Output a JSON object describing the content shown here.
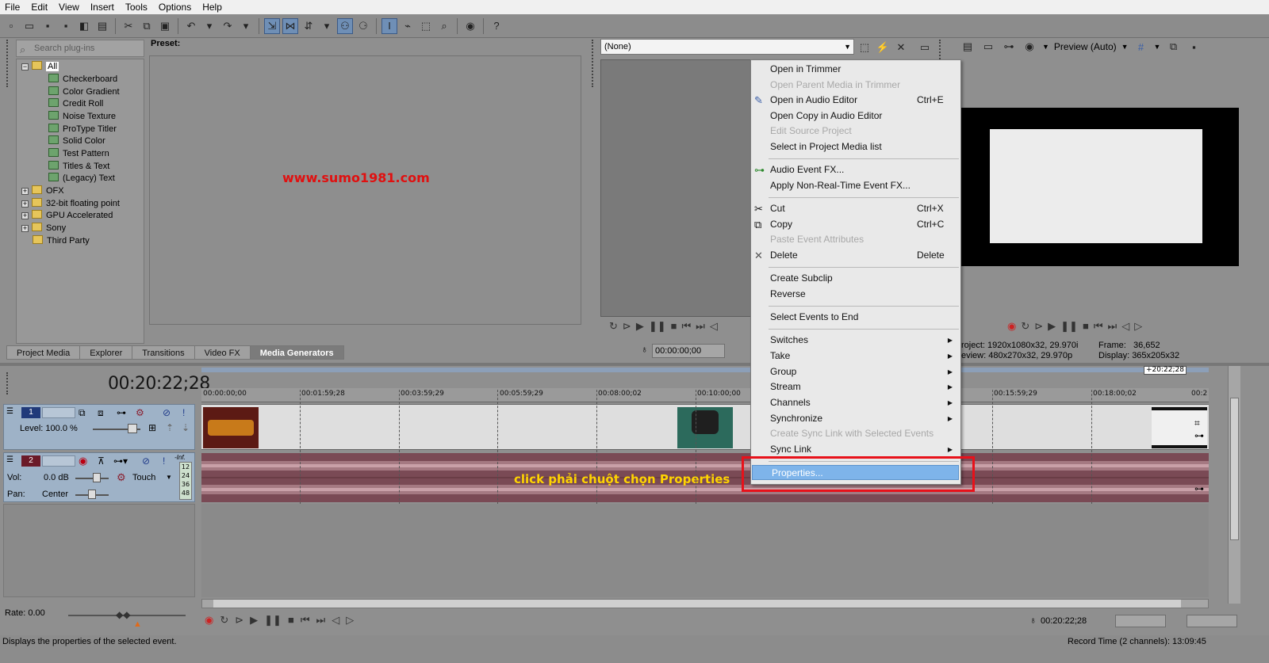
{
  "menubar": {
    "items": [
      "File",
      "Edit",
      "View",
      "Insert",
      "Tools",
      "Options",
      "Help"
    ]
  },
  "plugins": {
    "search_placeholder": "Search plug-ins",
    "preset_label": "Preset:",
    "tree": [
      {
        "label": "All",
        "type": "folder"
      },
      {
        "label": "Checkerboard",
        "type": "plugin"
      },
      {
        "label": "Color Gradient",
        "type": "plugin"
      },
      {
        "label": "Credit Roll",
        "type": "plugin"
      },
      {
        "label": "Noise Texture",
        "type": "plugin"
      },
      {
        "label": "ProType Titler",
        "type": "plugin"
      },
      {
        "label": "Solid Color",
        "type": "plugin"
      },
      {
        "label": "Test Pattern",
        "type": "plugin"
      },
      {
        "label": "Titles & Text",
        "type": "plugin"
      },
      {
        "label": "(Legacy) Text",
        "type": "plugin"
      },
      {
        "label": "OFX",
        "type": "folder"
      },
      {
        "label": "32-bit floating point",
        "type": "folder"
      },
      {
        "label": "GPU Accelerated",
        "type": "folder"
      },
      {
        "label": "Sony",
        "type": "folder"
      },
      {
        "label": "Third Party",
        "type": "folder"
      }
    ],
    "watermark": "www.sumo1981.com"
  },
  "tabs": [
    "Project Media",
    "Explorer",
    "Transitions",
    "Video FX",
    "Media Generators"
  ],
  "trimmer": {
    "select_value": "(None)",
    "timecode": "00:00:00;00"
  },
  "preview": {
    "mode_label": "Preview (Auto)",
    "project_label": "roject:",
    "project_value": "1920x1080x32, 29.970i",
    "preview_label": "eview:",
    "preview_value": "480x270x32, 29.970p",
    "frame_label": "Frame:",
    "frame_value": "36,652",
    "display_label": "Display:",
    "display_value": "365x205x32"
  },
  "timeline": {
    "timecode": "00:20:22;28",
    "marker": "+20:22;28",
    "ruler": [
      "00:00:00;00",
      "00:01:59;28",
      "00:03:59;29",
      "00:05:59;29",
      "00:08:00;02",
      "00:10:00;00",
      "00:15:59;29",
      "00:18:00;02",
      "00:2"
    ],
    "video_track": {
      "number": "1",
      "level": "Level: 100.0 %"
    },
    "audio_track": {
      "number": "2",
      "vol_label": "Vol:",
      "vol_value": "0.0 dB",
      "pan_label": "Pan:",
      "pan_value": "Center",
      "touch": "Touch",
      "meter_top": "-Inf.",
      "meter_marks": [
        "12",
        "24",
        "36",
        "48"
      ]
    },
    "audio_caption": "click phải chuột chọn Properties",
    "rate": "Rate: 0.00",
    "bottom_timecode": "00:20:22;28"
  },
  "context_menu": {
    "items": [
      {
        "label": "Open in Trimmer",
        "disabled": false
      },
      {
        "label": "Open Parent Media in Trimmer",
        "disabled": true
      },
      {
        "label": "Open in Audio Editor",
        "shortcut": "Ctrl+E",
        "icon": "audio-editor-icon",
        "disabled": false
      },
      {
        "label": "Open Copy in Audio Editor",
        "disabled": false
      },
      {
        "label": "Edit Source Project",
        "disabled": true
      },
      {
        "label": "Select in Project Media list",
        "disabled": false
      },
      {
        "label": "Audio Event FX...",
        "icon": "fx-plug-icon",
        "disabled": false
      },
      {
        "label": "Apply Non-Real-Time Event FX...",
        "disabled": false
      },
      {
        "label": "Cut",
        "shortcut": "Ctrl+X",
        "icon": "scissors-icon",
        "disabled": false
      },
      {
        "label": "Copy",
        "shortcut": "Ctrl+C",
        "icon": "copy-icon",
        "disabled": false
      },
      {
        "label": "Paste Event Attributes",
        "disabled": true
      },
      {
        "label": "Delete",
        "shortcut": "Delete",
        "icon": "delete-x-icon",
        "disabled": false
      },
      {
        "label": "Create Subclip",
        "disabled": false
      },
      {
        "label": "Reverse",
        "disabled": false
      },
      {
        "label": "Select Events to End",
        "disabled": false
      },
      {
        "label": "Switches",
        "submenu": true,
        "disabled": false
      },
      {
        "label": "Take",
        "submenu": true,
        "disabled": false
      },
      {
        "label": "Group",
        "submenu": true,
        "disabled": false
      },
      {
        "label": "Stream",
        "submenu": true,
        "disabled": false
      },
      {
        "label": "Channels",
        "submenu": true,
        "disabled": false
      },
      {
        "label": "Synchronize",
        "submenu": true,
        "disabled": false
      },
      {
        "label": "Create Sync Link with Selected Events",
        "disabled": true
      },
      {
        "label": "Sync Link",
        "submenu": true,
        "disabled": false
      },
      {
        "label": "Properties...",
        "highlighted": true,
        "disabled": false
      }
    ],
    "highlight_color": "#7eb4ea",
    "annotation_box_color": "#e8111a"
  },
  "status": {
    "left": "Displays the properties of the selected event.",
    "right": "Record Time (2 channels): 13:09:45"
  }
}
